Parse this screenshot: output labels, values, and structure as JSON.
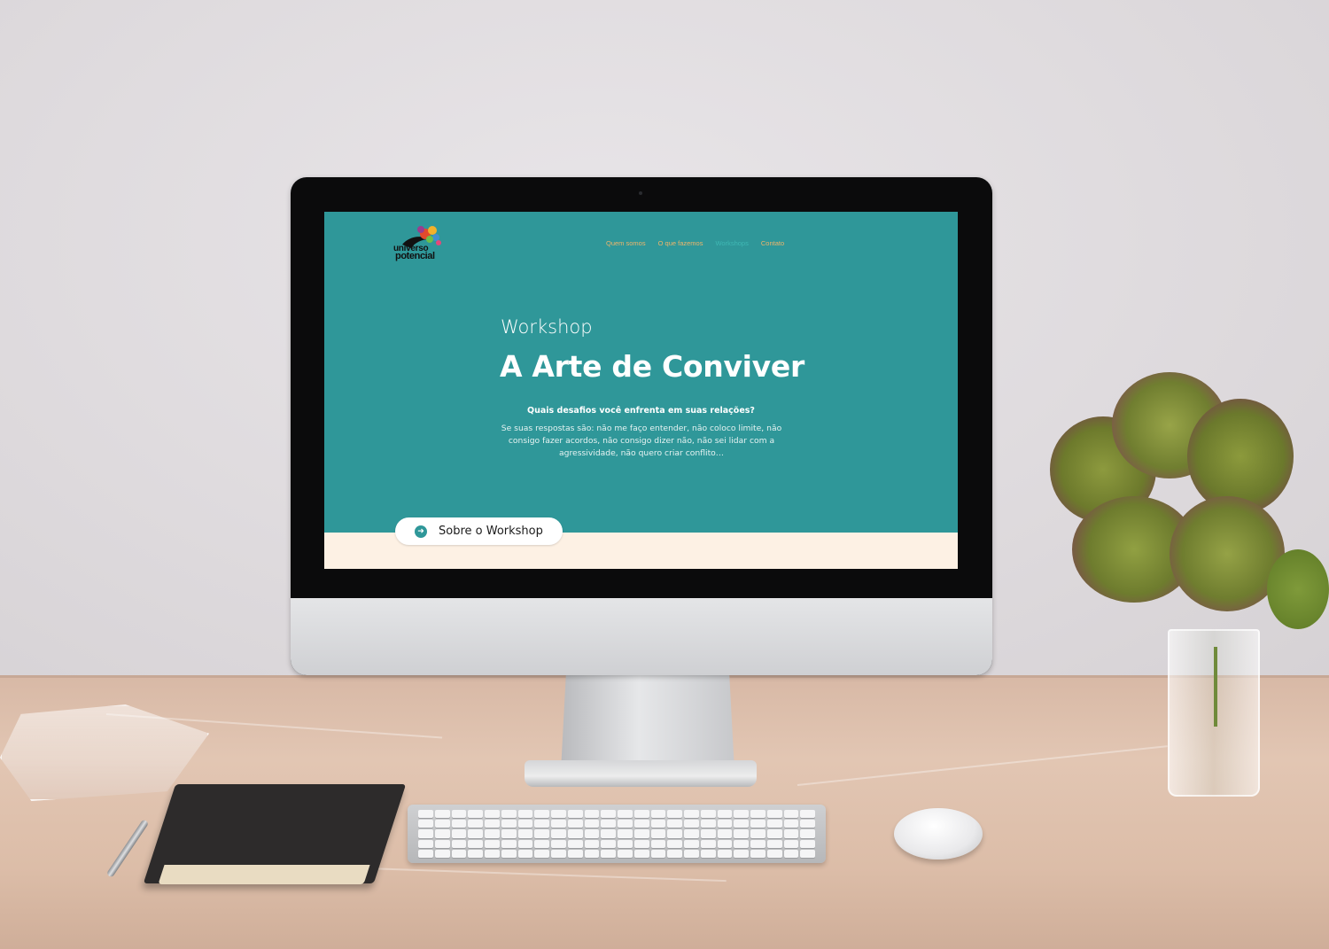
{
  "site": {
    "logo": {
      "line1": "universo",
      "line2": "potencial"
    },
    "nav": {
      "items": [
        {
          "label": "Quem somos",
          "active": false
        },
        {
          "label": "O que fazemos",
          "active": false
        },
        {
          "label": "Workshops",
          "active": true
        },
        {
          "label": "Contato",
          "active": false
        }
      ]
    },
    "hero": {
      "eyebrow": "Workshop",
      "title": "A Arte de Conviver",
      "question": "Quais desafios você enfrenta em suas relações?",
      "paragraph": "Se suas respostas são: não me faço entender, não coloco limite, não consigo fazer acordos, não consigo dizer não, não sei lidar com a agressividade, não quero criar conflito…",
      "cta_label": "Sobre o Workshop",
      "cta_icon": "arrow-right-circle-icon"
    },
    "colors": {
      "background": "#2f9799",
      "nav_link": "#f0b56a",
      "nav_active": "#3fb8b4",
      "footer_band": "#fdf1e4",
      "cta_background": "#ffffff"
    }
  }
}
